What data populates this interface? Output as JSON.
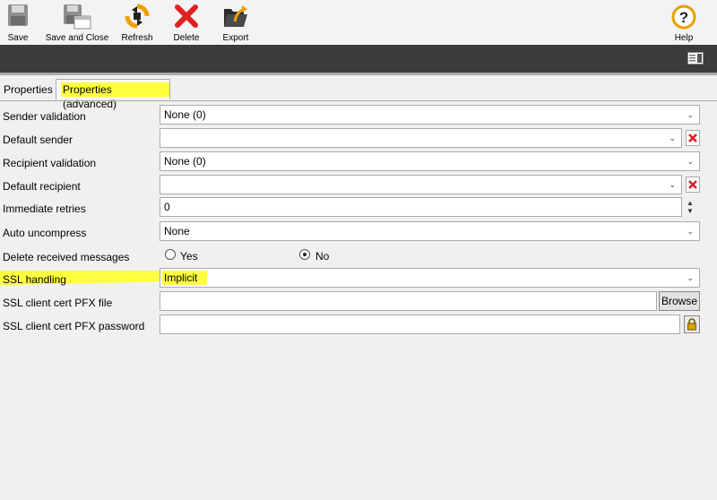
{
  "toolbar": {
    "save": "Save",
    "save_close": "Save and Close",
    "refresh": "Refresh",
    "delete": "Delete",
    "export": "Export",
    "help": "Help"
  },
  "tabs": [
    {
      "label": "Properties",
      "active": false
    },
    {
      "label": "Properties (advanced)",
      "active": true
    }
  ],
  "form": {
    "sender_validation": {
      "label": "Sender validation",
      "value": "None (0)"
    },
    "default_sender": {
      "label": "Default sender",
      "value": ""
    },
    "recipient_validation": {
      "label": "Recipient validation",
      "value": "None (0)"
    },
    "default_recipient": {
      "label": "Default recipient",
      "value": ""
    },
    "immediate_retries": {
      "label": "Immediate retries",
      "value": "0"
    },
    "auto_uncompress": {
      "label": "Auto uncompress",
      "value": "None"
    },
    "delete_received": {
      "label": "Delete received messages",
      "options": [
        "Yes",
        "No"
      ],
      "selected": "No"
    },
    "ssl_handling": {
      "label": "SSL handling",
      "value": "Implicit"
    },
    "ssl_cert_file": {
      "label": "SSL client cert PFX file",
      "value": "",
      "browse": "Browse"
    },
    "ssl_cert_password": {
      "label": "SSL client cert PFX password",
      "value": ""
    }
  },
  "colors": {
    "highlight": "#ffff40",
    "delete_red": "#e02020",
    "dark_bar": "#3c3c3c",
    "help_orange": "#e8a000"
  },
  "icons": [
    "save-icon",
    "save-close-icon",
    "refresh-icon",
    "delete-icon",
    "export-icon",
    "help-icon",
    "panel-toggle-icon",
    "clear-icon",
    "lock-icon"
  ]
}
